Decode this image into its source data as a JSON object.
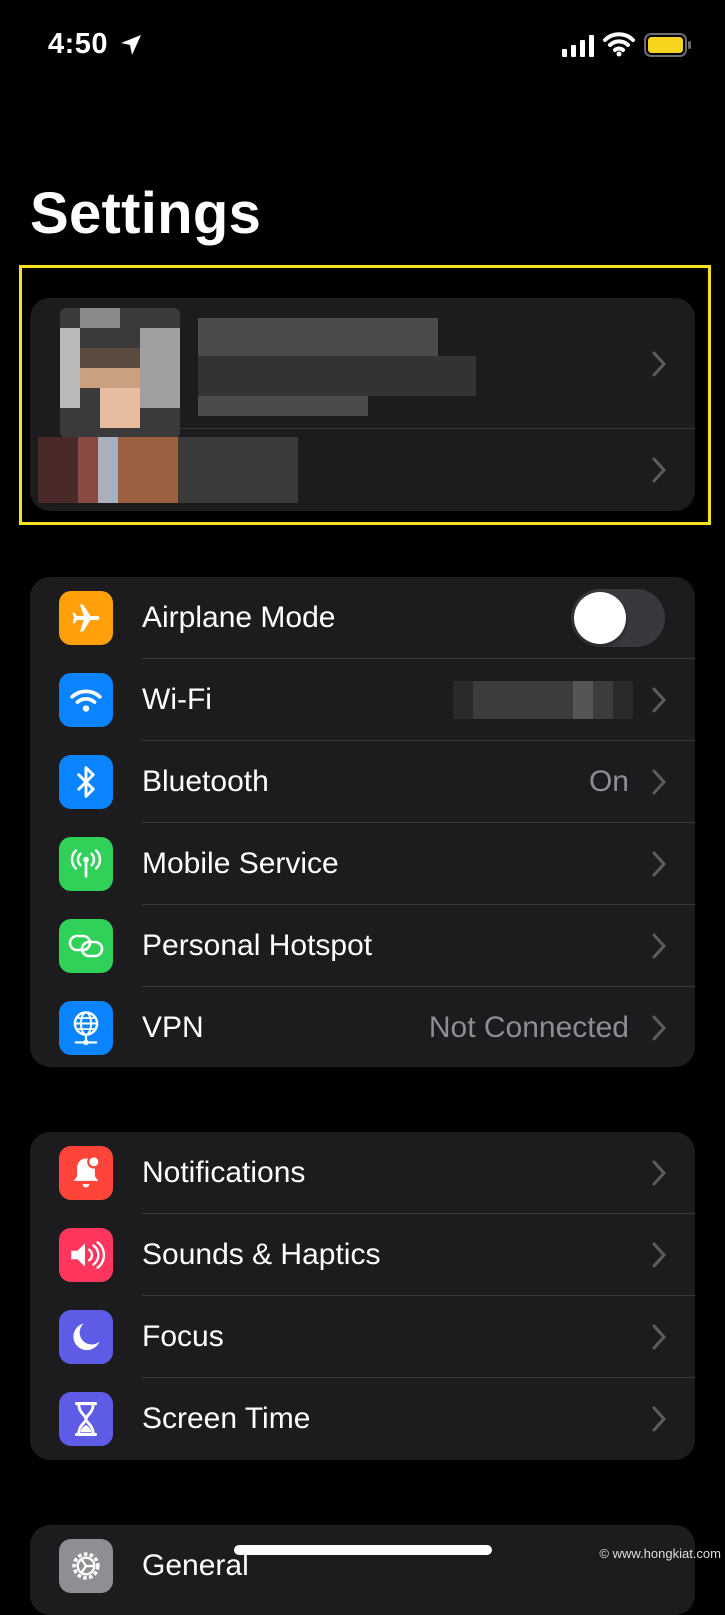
{
  "status_bar": {
    "time": "4:50",
    "icons": [
      "location-arrow-icon",
      "cellular-signal-icon",
      "wifi-icon",
      "battery-icon"
    ],
    "battery_color": "#f7d41e",
    "low_power_mode": true
  },
  "page": {
    "title": "Settings"
  },
  "profile_section": {
    "highlighted": true,
    "highlight_color": "#f5e21c",
    "account_row": {
      "name": "",
      "subtitle": "",
      "redacted": true
    },
    "suggestion_row": {
      "label": "",
      "redacted": true
    }
  },
  "connectivity_group": [
    {
      "id": "airplane",
      "label": "Airplane Mode",
      "icon": "airplane-icon",
      "icon_bg": "#ff9f0a",
      "toggle": true,
      "toggle_on": false
    },
    {
      "id": "wifi",
      "label": "Wi-Fi",
      "icon": "wifi-icon",
      "icon_bg": "#0a84ff",
      "value": "",
      "value_redacted": true
    },
    {
      "id": "bluetooth",
      "label": "Bluetooth",
      "icon": "bluetooth-icon",
      "icon_bg": "#0a84ff",
      "value": "On"
    },
    {
      "id": "mobile",
      "label": "Mobile Service",
      "icon": "antenna-icon",
      "icon_bg": "#30d158"
    },
    {
      "id": "hotspot",
      "label": "Personal Hotspot",
      "icon": "link-chain-icon",
      "icon_bg": "#30d158"
    },
    {
      "id": "vpn",
      "label": "VPN",
      "icon": "globe-network-icon",
      "icon_bg": "#0a84ff",
      "value": "Not Connected"
    }
  ],
  "attention_group": [
    {
      "id": "notifications",
      "label": "Notifications",
      "icon": "bell-badge-icon",
      "icon_bg": "#ff453a"
    },
    {
      "id": "sounds",
      "label": "Sounds & Haptics",
      "icon": "speaker-wave-icon",
      "icon_bg": "#ff375f"
    },
    {
      "id": "focus",
      "label": "Focus",
      "icon": "moon-icon",
      "icon_bg": "#5e5ce6"
    },
    {
      "id": "screentime",
      "label": "Screen Time",
      "icon": "hourglass-icon",
      "icon_bg": "#5e5ce6"
    }
  ],
  "general_group": [
    {
      "id": "general",
      "label": "General",
      "icon": "gear-icon",
      "icon_bg": "#8e8e93"
    }
  ],
  "watermark": "© www.hongkiat.com"
}
